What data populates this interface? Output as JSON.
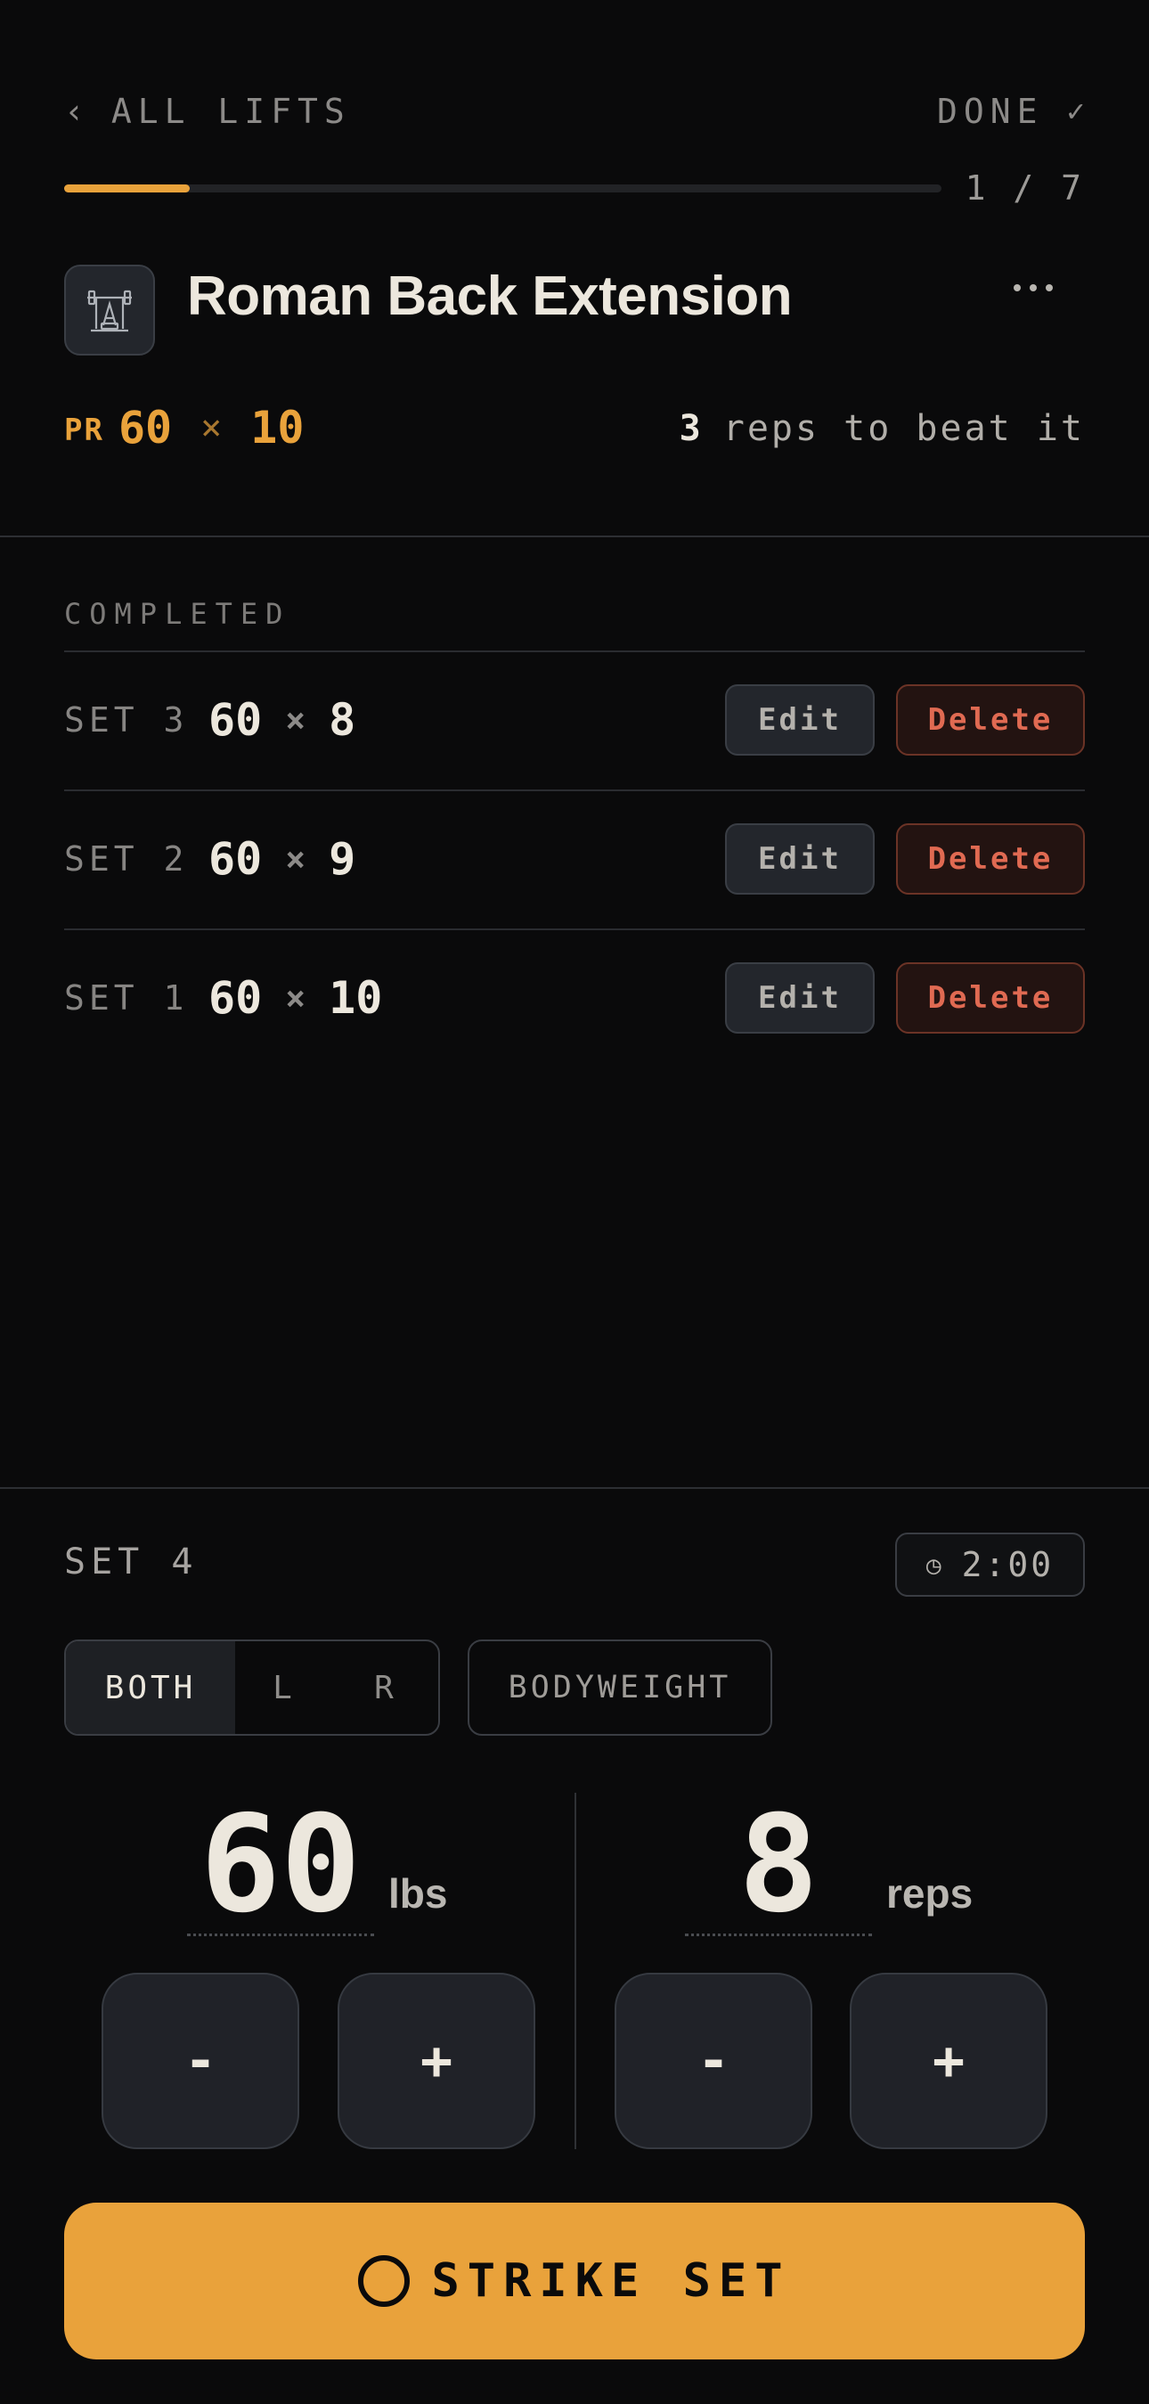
{
  "header": {
    "back_chevron": "‹",
    "back_label": "ALL LIFTS",
    "done_label": "DONE",
    "done_check": "✓",
    "progress_fraction": 0.143,
    "counter": "1 / 7"
  },
  "lift": {
    "icon": "barbell-rack-icon",
    "title": "Roman Back Extension",
    "more": "more-options-icon"
  },
  "pr": {
    "label": "PR",
    "weight": "60",
    "times": "×",
    "reps": "10",
    "beat_count": "3",
    "beat_text": "reps to beat it"
  },
  "completed": {
    "label": "COMPLETED",
    "edit_label": "Edit",
    "delete_label": "Delete",
    "sets": [
      {
        "label": "SET 3",
        "weight": "60",
        "times": "×",
        "reps": "8"
      },
      {
        "label": "SET 2",
        "weight": "60",
        "times": "×",
        "reps": "9"
      },
      {
        "label": "SET 1",
        "weight": "60",
        "times": "×",
        "reps": "10"
      }
    ]
  },
  "entry": {
    "set_label": "SET 4",
    "timer_icon": "◷",
    "timer": "2:00",
    "sides": [
      "BOTH",
      "L",
      "R"
    ],
    "active_side": "BOTH",
    "bodyweight_label": "BODYWEIGHT",
    "weight": "60",
    "weight_unit": "lbs",
    "reps": "8",
    "reps_unit": "reps",
    "minus": "-",
    "plus": "+",
    "strike_label": "STRIKE SET"
  },
  "colors": {
    "accent": "#e9a23b",
    "delete": "#e06a52",
    "background": "#0a0a0b"
  }
}
